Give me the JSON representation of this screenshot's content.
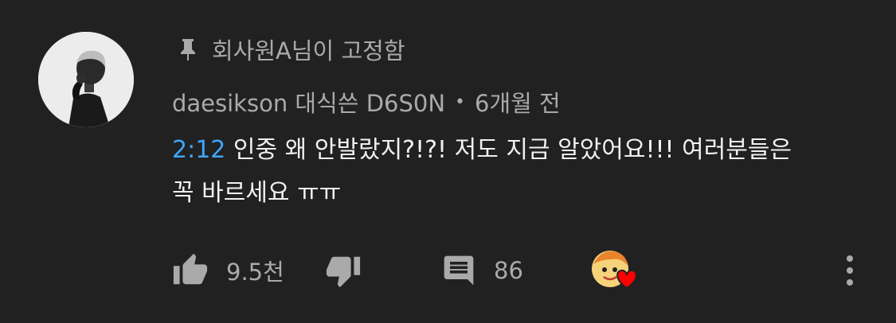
{
  "pin": {
    "text": "회사원A님이 고정함",
    "icon": "pin-icon"
  },
  "comment": {
    "author": "daesikson 대식쓴 D6S0N",
    "separator": "•",
    "time": "6개월 전",
    "timestamp_link": "2:12",
    "text_line1_rest": " 인중 왜 안발랐지?!?! 저도 지금 알았어요!!! 여러분들은",
    "text_line2": "꼭 바르세요 ㅠㅠ"
  },
  "actions": {
    "like_count": "9.5천",
    "reply_count": "86",
    "icons": {
      "like": "thumbs-up-icon",
      "dislike": "thumbs-down-icon",
      "reply": "comment-icon",
      "heart": "creator-heart-icon",
      "more": "more-vert-icon"
    }
  },
  "colors": {
    "background": "#212121",
    "text_primary": "#f1f1f1",
    "text_secondary": "#aaaaaa",
    "link": "#3ea6ff",
    "heart": "#ff0000"
  }
}
